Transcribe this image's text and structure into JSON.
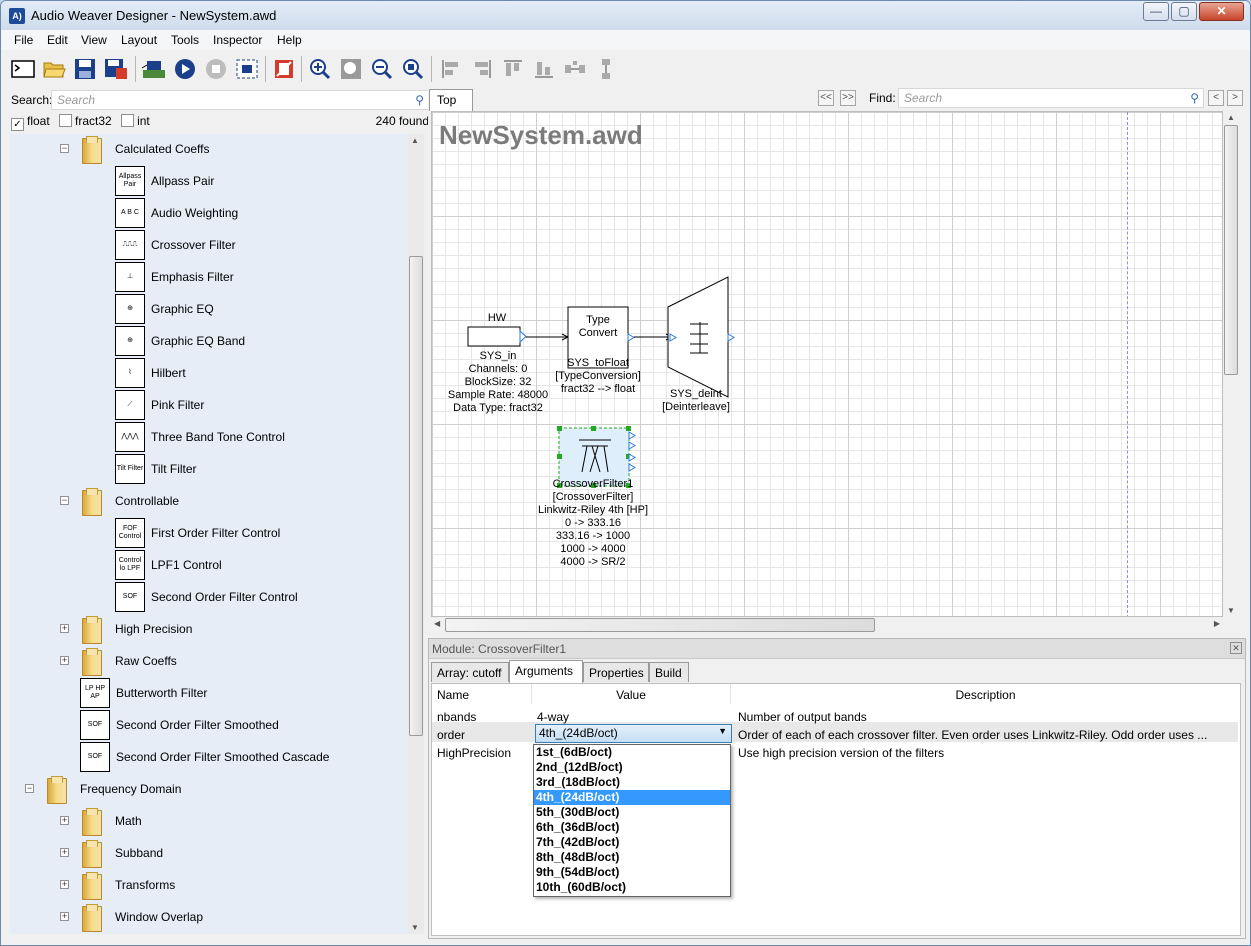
{
  "window": {
    "title": "Audio Weaver Designer - NewSystem.awd",
    "app_icon": "A)",
    "minimize": "—",
    "maximize": "▢",
    "close": "✕"
  },
  "menu": [
    "File",
    "Edit",
    "View",
    "Layout",
    "Tools",
    "Inspector",
    "Help"
  ],
  "toolbar": {
    "icons": [
      "new-icon",
      "open-icon",
      "save-icon",
      "save-all-icon",
      "build-icon",
      "run-icon",
      "stop-icon",
      "generate-icon",
      "pause-icon",
      "zoom-in-icon",
      "zoom-fit-icon",
      "zoom-out-icon",
      "zoom-reset-icon",
      "align-left-icon",
      "align-right-icon",
      "align-top-icon",
      "align-bottom-icon",
      "distribute-h-icon",
      "distribute-v-icon"
    ]
  },
  "browser": {
    "search_label": "Search:",
    "search_placeholder": "Search",
    "filters": [
      {
        "label": "float",
        "checked": true
      },
      {
        "label": "fract32",
        "checked": false
      },
      {
        "label": "int",
        "checked": false
      }
    ],
    "found": "240 found",
    "tree": [
      {
        "type": "folder",
        "label": "Calculated Coeffs",
        "expander": "−",
        "level": 1
      },
      {
        "type": "module",
        "label": "Allpass Pair",
        "icon_text": "Allpass Pair",
        "level": 2
      },
      {
        "type": "module",
        "label": "Audio Weighting",
        "icon_text": "A B C",
        "level": 2
      },
      {
        "type": "module",
        "label": "Crossover Filter",
        "icon_text": "⎍⎍⎍",
        "level": 2
      },
      {
        "type": "module",
        "label": "Emphasis Filter",
        "icon_text": "⊥",
        "level": 2
      },
      {
        "type": "module",
        "label": "Graphic EQ",
        "icon_text": "⊕",
        "level": 2
      },
      {
        "type": "module",
        "label": "Graphic EQ Band",
        "icon_text": "⊕",
        "level": 2
      },
      {
        "type": "module",
        "label": "Hilbert",
        "icon_text": "⌇",
        "level": 2
      },
      {
        "type": "module",
        "label": "Pink Filter",
        "icon_text": "⟋",
        "level": 2
      },
      {
        "type": "module",
        "label": "Three Band Tone Control",
        "icon_text": "⋀⋀⋀",
        "level": 2
      },
      {
        "type": "module",
        "label": "Tilt Filter",
        "icon_text": "Tilt Filter",
        "level": 2
      },
      {
        "type": "folder",
        "label": "Controllable",
        "expander": "−",
        "level": 1
      },
      {
        "type": "module",
        "label": "First Order Filter Control",
        "icon_text": "FOF Control",
        "level": 2
      },
      {
        "type": "module",
        "label": "LPF1 Control",
        "icon_text": "Control lo LPF",
        "level": 2
      },
      {
        "type": "module",
        "label": "Second Order Filter Control",
        "icon_text": "SOF",
        "level": 2
      },
      {
        "type": "folder",
        "label": "High Precision",
        "expander": "+",
        "level": 1
      },
      {
        "type": "folder",
        "label": "Raw Coeffs",
        "expander": "+",
        "level": 1
      },
      {
        "type": "module",
        "label": "Butterworth Filter",
        "icon_text": "LP HP AP",
        "level": 1
      },
      {
        "type": "module",
        "label": "Second Order Filter Smoothed",
        "icon_text": "SOF",
        "level": 1
      },
      {
        "type": "module",
        "label": "Second Order Filter Smoothed Cascade",
        "icon_text": "SOF",
        "level": 1
      },
      {
        "type": "folder",
        "label": "Frequency Domain",
        "expander": "−",
        "level": 0
      },
      {
        "type": "folder",
        "label": "Math",
        "expander": "+",
        "level": 1
      },
      {
        "type": "folder",
        "label": "Subband",
        "expander": "+",
        "level": 1
      },
      {
        "type": "folder",
        "label": "Transforms",
        "expander": "+",
        "level": 1
      },
      {
        "type": "folder",
        "label": "Window Overlap",
        "expander": "+",
        "level": 1
      }
    ]
  },
  "canvas_panel": {
    "tab": "Top",
    "nav_prev": "<<",
    "nav_next": ">>",
    "find_label": "Find:",
    "find_placeholder": "Search",
    "system_title": "NewSystem.awd",
    "blocks": {
      "hw_label": "HW",
      "sys_in_text": [
        "SYS_in",
        "Channels: 0",
        "BlockSize: 32",
        "Sample Rate: 48000",
        "Data Type: fract32"
      ],
      "type_convert_label": [
        "Type",
        "Convert"
      ],
      "sys_tofloat_text": [
        "SYS_toFloat",
        "[TypeConversion]",
        "fract32 --> float"
      ],
      "sys_deint_text": [
        "SYS_deint",
        "[Deinterleave]"
      ],
      "crossover_text": [
        "CrossoverFilter1",
        "[CrossoverFilter]",
        "Linkwitz-Riley 4th [HP]",
        "0 -> 333.16",
        "333.16 -> 1000",
        "1000 -> 4000",
        "4000 -> SR/2"
      ]
    }
  },
  "module_panel": {
    "header": "Module: CrossoverFilter1",
    "tabs": [
      "Array: cutoff",
      "Arguments",
      "Properties",
      "Build"
    ],
    "active_tab": "Arguments",
    "columns": [
      "Name",
      "Value",
      "Description"
    ],
    "rows": [
      {
        "name": "nbands",
        "value": "4-way",
        "description": "Number of output bands"
      },
      {
        "name": "order",
        "value": "4th_(24dB/oct)",
        "description": "Order of each of each crossover filter. Even order uses Linkwitz-Riley. Odd order uses ..."
      },
      {
        "name": "HighPrecision",
        "value": "",
        "description": "Use high precision version of the filters"
      }
    ],
    "order_options": [
      "1st_(6dB/oct)",
      "2nd_(12dB/oct)",
      "3rd_(18dB/oct)",
      "4th_(24dB/oct)",
      "5th_(30dB/oct)",
      "6th_(36dB/oct)",
      "7th_(42dB/oct)",
      "8th_(48dB/oct)",
      "9th_(54dB/oct)",
      "10th_(60dB/oct)"
    ],
    "selected_option": "4th_(24dB/oct)"
  },
  "colors": {
    "tree_bg": "#e6edf7",
    "selection": "#3399ff",
    "port": "#2a7bd6",
    "select_box": "#22aa22"
  }
}
